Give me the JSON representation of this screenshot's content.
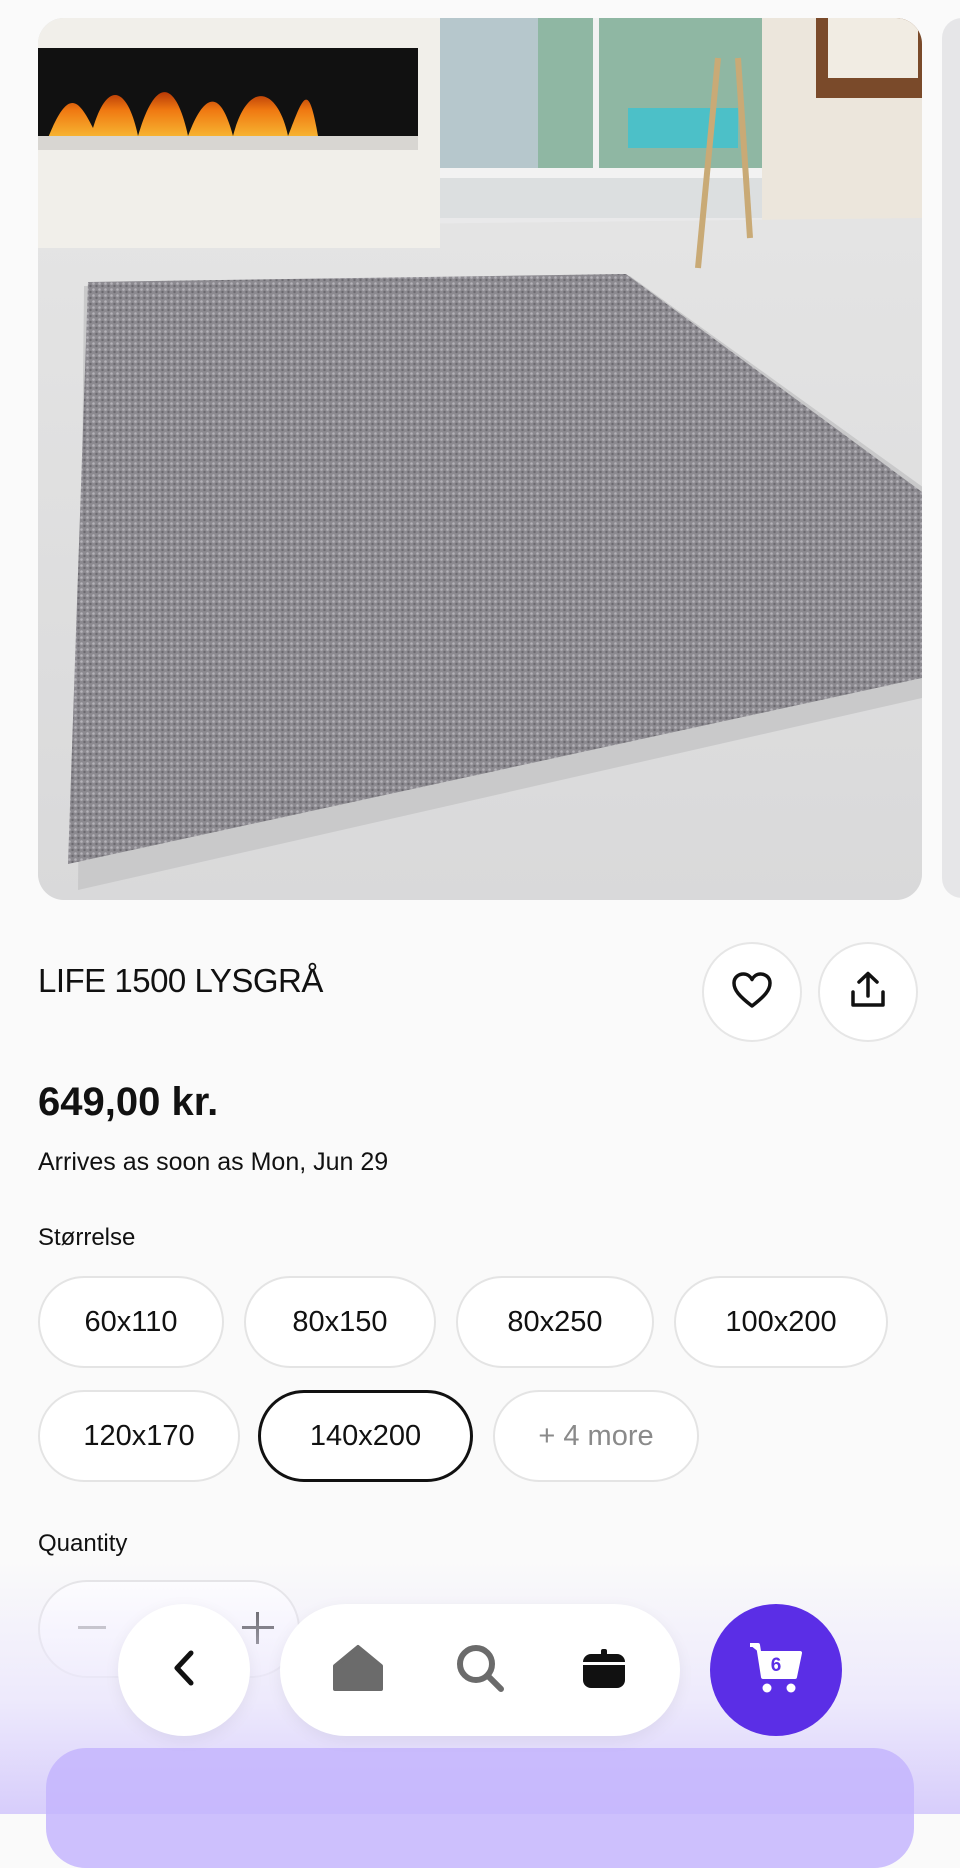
{
  "product": {
    "title": "LIFE 1500 LYSGRÅ",
    "price": "649,00 kr.",
    "arrival": "Arrives as soon as Mon, Jun 29"
  },
  "size": {
    "label": "Størrelse",
    "options": [
      "60x110",
      "80x150",
      "80x250",
      "100x200",
      "120x170",
      "140x200"
    ],
    "selected": "140x200",
    "more_label": "+ 4 more"
  },
  "quantity": {
    "label": "Quantity"
  },
  "nav": {
    "cart_count": "6"
  },
  "icons": {
    "favorite": "heart-icon",
    "share": "share-icon",
    "back": "chevron-left-icon",
    "home": "home-icon",
    "search": "search-icon",
    "orders": "bag-icon",
    "cart": "cart-icon"
  },
  "colors": {
    "accent": "#5b2ee6",
    "background": "#fafafa",
    "rug": "#8f8d93"
  }
}
